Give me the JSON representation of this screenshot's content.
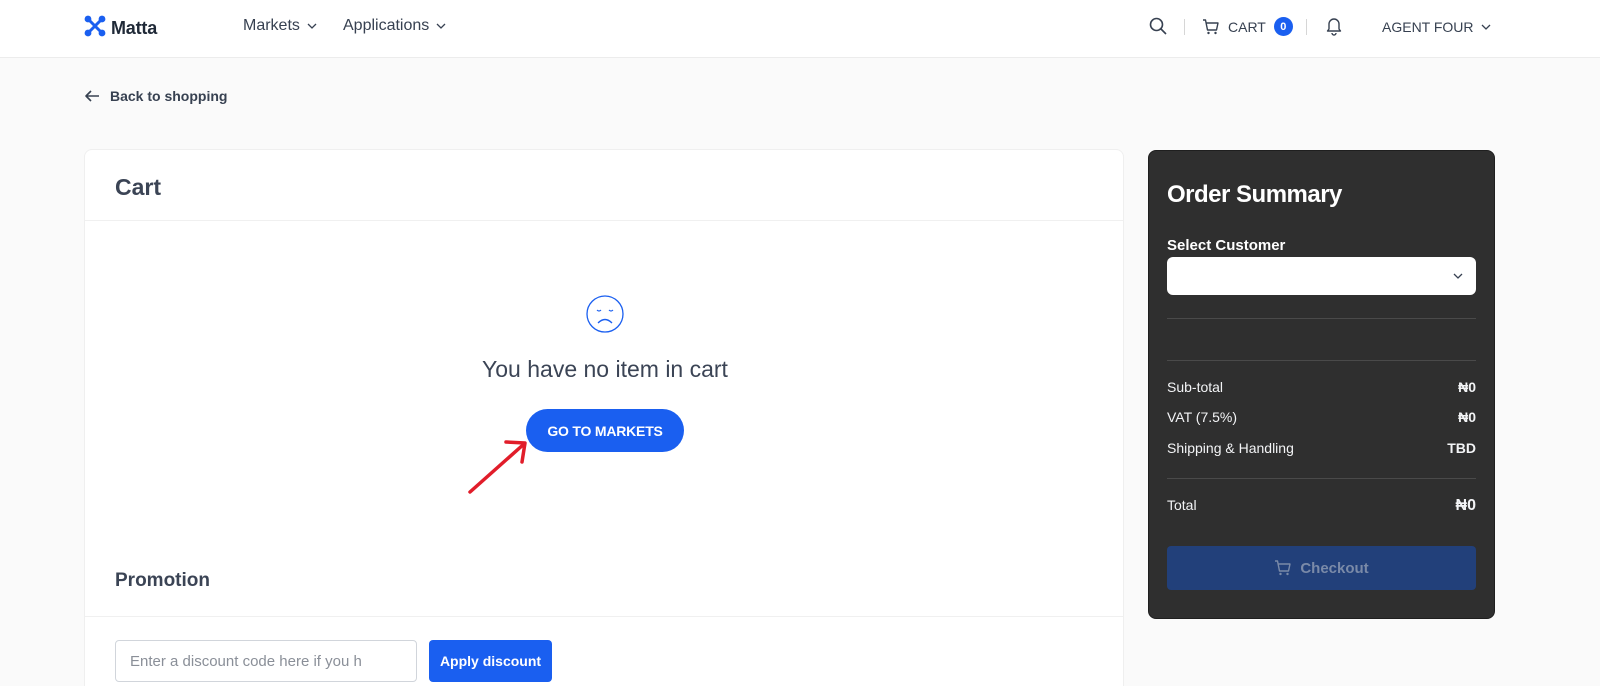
{
  "header": {
    "logo_text": "Matta",
    "nav": [
      {
        "label": "Markets"
      },
      {
        "label": "Applications"
      }
    ],
    "cart_label": "CART",
    "cart_count": "0",
    "user_label": "AGENT FOUR"
  },
  "back_link": "Back to shopping",
  "cart": {
    "title": "Cart",
    "empty_message": "You have no item in cart",
    "go_button": "GO TO MARKETS",
    "promotion_title": "Promotion",
    "discount_placeholder": "Enter a discount code here if you h",
    "apply_button": "Apply discount"
  },
  "summary": {
    "title": "Order Summary",
    "customer_label": "Select Customer",
    "customer_value": "",
    "rows": [
      {
        "label": "Sub-total",
        "value": "₦0"
      },
      {
        "label": "VAT (7.5%)",
        "value": "₦0"
      },
      {
        "label": "Shipping & Handling",
        "value": "TBD"
      }
    ],
    "total_label": "Total",
    "total_value": "₦0",
    "checkout_button": "Checkout"
  },
  "colors": {
    "accent": "#1a5ff0",
    "summary_bg": "#2f2f2f",
    "checkout_disabled": "#22407a",
    "annotation_arrow": "#e11d2a"
  }
}
